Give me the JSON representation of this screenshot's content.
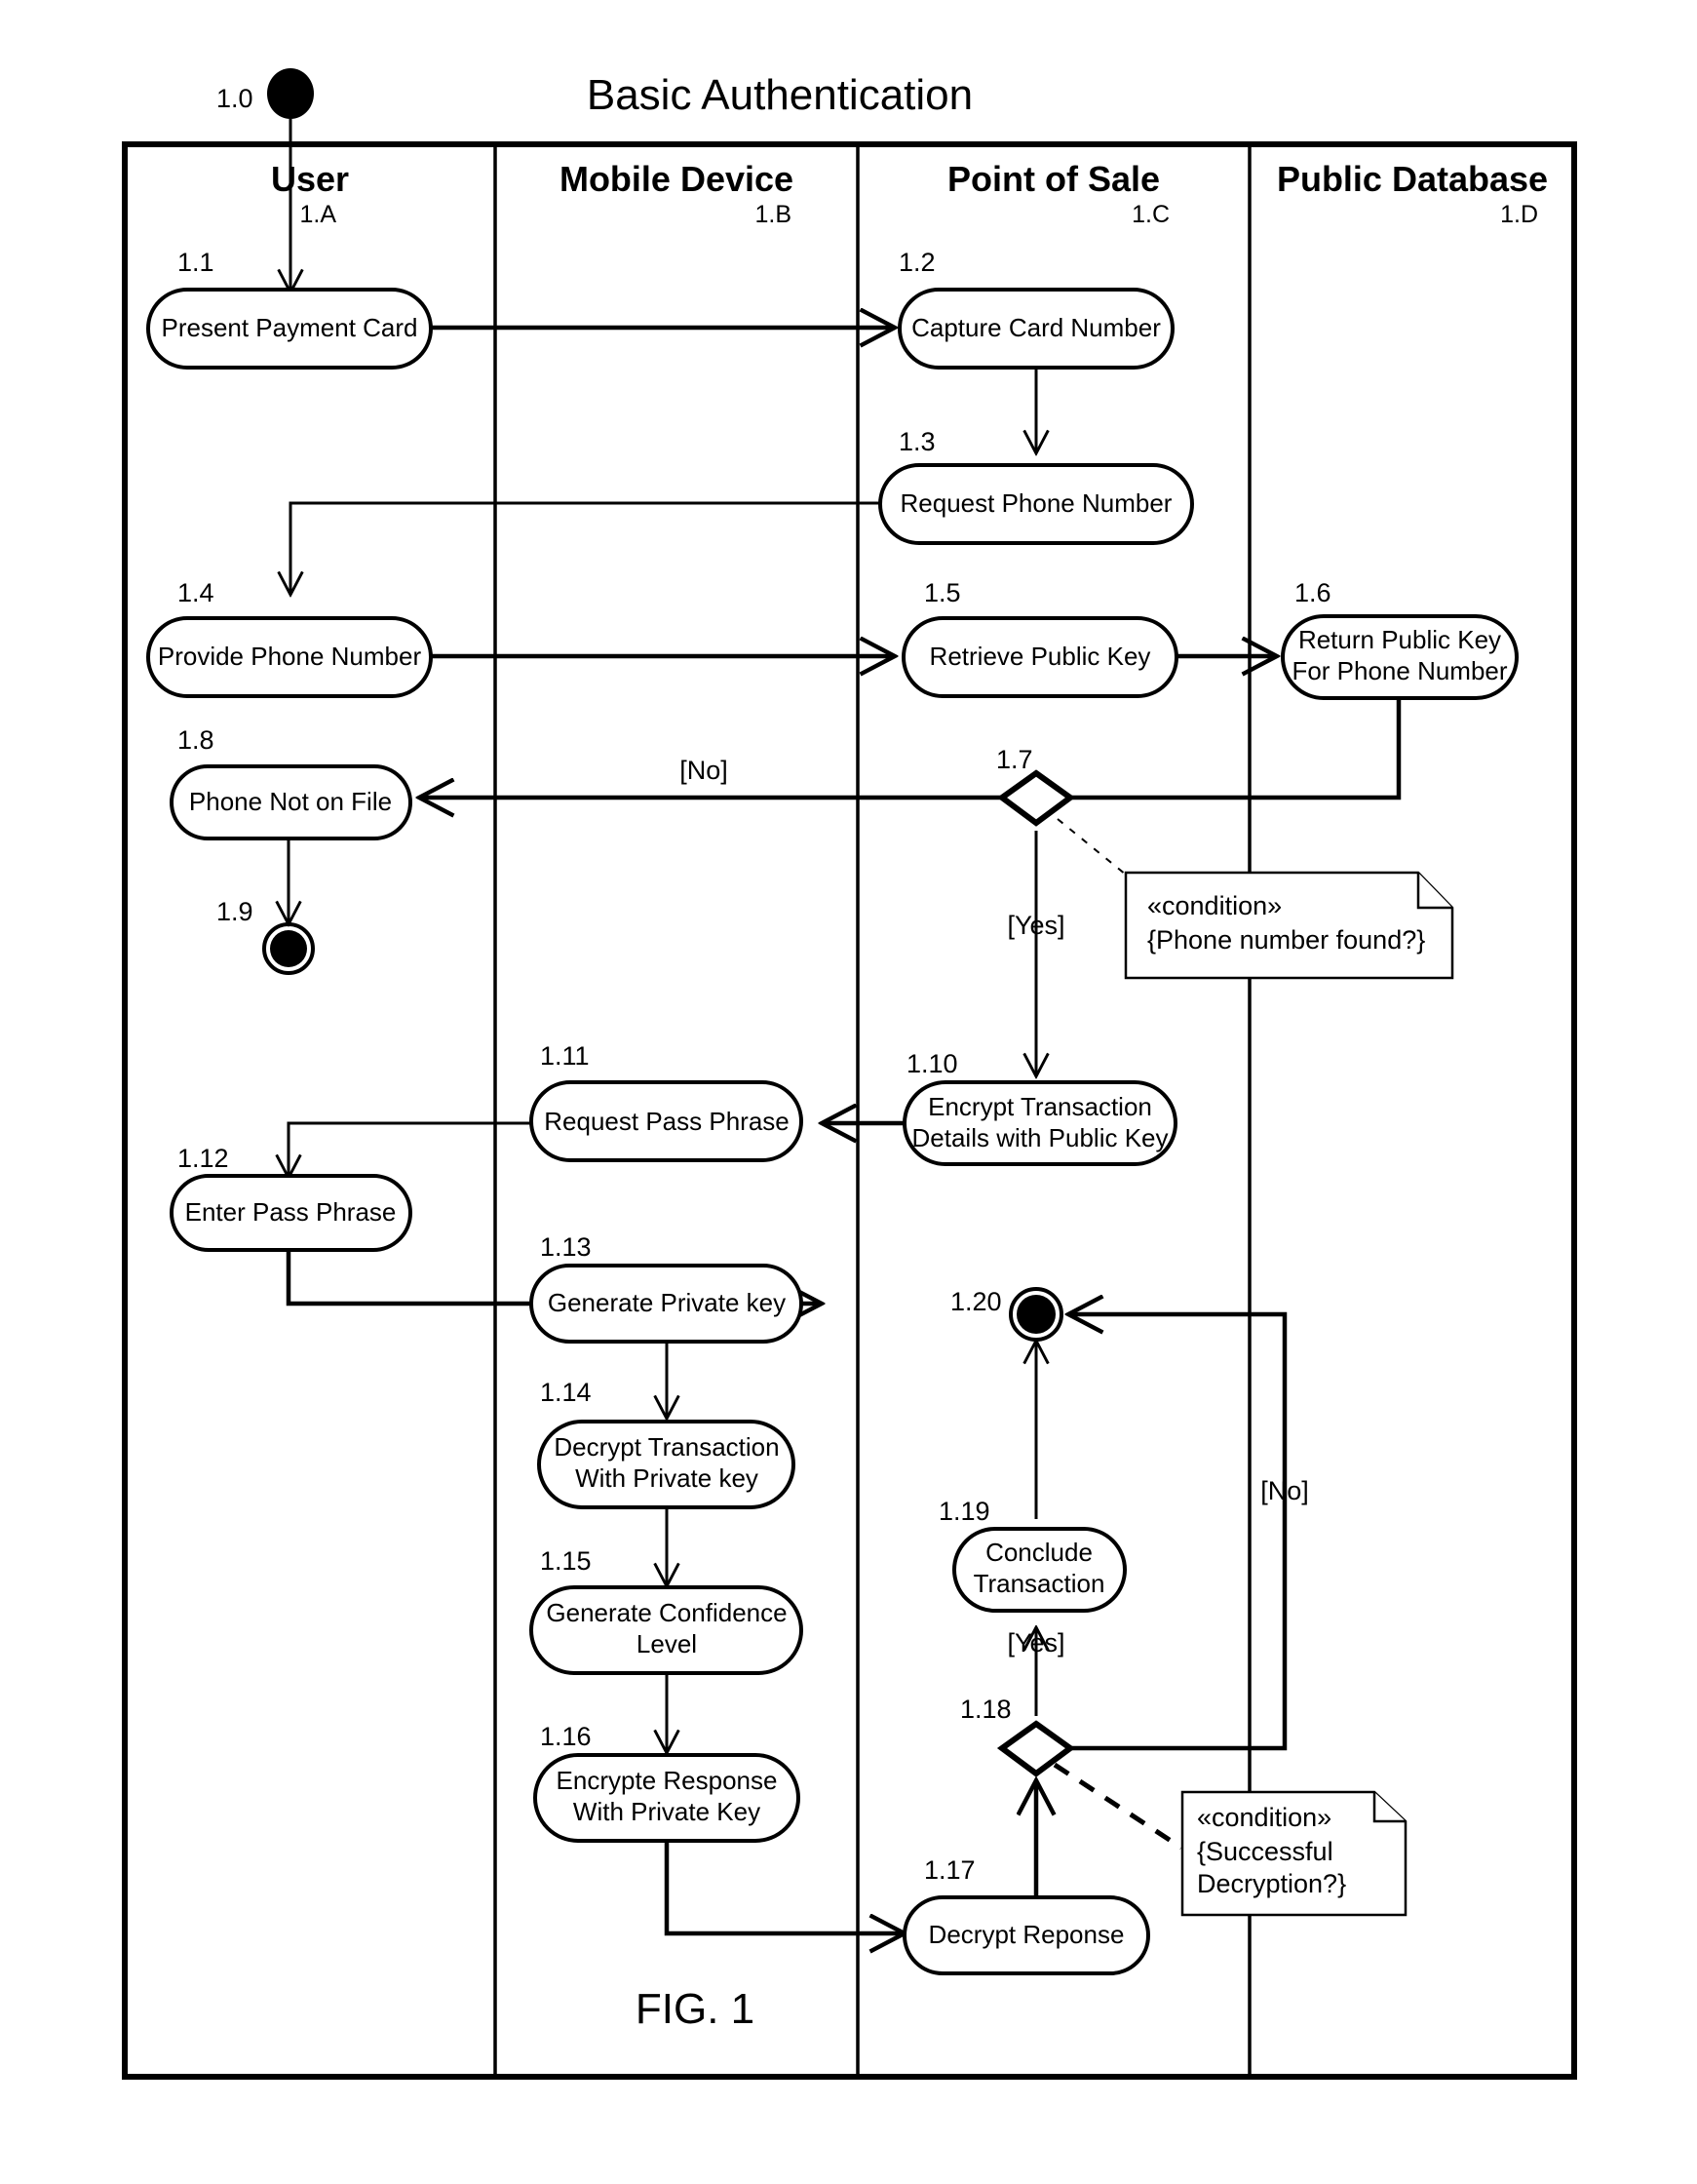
{
  "title": "Basic Authentication",
  "figure_label": "FIG. 1",
  "start_node": {
    "id": "1.0",
    "type": "initial-node"
  },
  "lanes": [
    {
      "name": "User",
      "num": "1.A"
    },
    {
      "name": "Mobile Device",
      "num": "1.B"
    },
    {
      "name": "Point of Sale",
      "num": "1.C"
    },
    {
      "name": "Public Database",
      "num": "1.D"
    }
  ],
  "nodes": [
    {
      "id": "1.1",
      "lane": "User",
      "type": "action",
      "label_line1": "Present Payment Card",
      "label_line2": ""
    },
    {
      "id": "1.2",
      "lane": "Point of Sale",
      "type": "action",
      "label_line1": "Capture Card Number",
      "label_line2": ""
    },
    {
      "id": "1.3",
      "lane": "Point of Sale",
      "type": "action",
      "label_line1": "Request Phone Number",
      "label_line2": ""
    },
    {
      "id": "1.4",
      "lane": "User",
      "type": "action",
      "label_line1": "Provide Phone Number",
      "label_line2": ""
    },
    {
      "id": "1.5",
      "lane": "Point of Sale",
      "type": "action",
      "label_line1": "Retrieve Public Key",
      "label_line2": ""
    },
    {
      "id": "1.6",
      "lane": "Public Database",
      "type": "action",
      "label_line1": "Return Public Key",
      "label_line2": "For Phone Number"
    },
    {
      "id": "1.7",
      "lane": "Point of Sale",
      "type": "decision",
      "label_line1": "",
      "label_line2": ""
    },
    {
      "id": "1.8",
      "lane": "User",
      "type": "action",
      "label_line1": "Phone Not on File",
      "label_line2": ""
    },
    {
      "id": "1.9",
      "lane": "User",
      "type": "final-node",
      "label_line1": "",
      "label_line2": ""
    },
    {
      "id": "1.10",
      "lane": "Point of Sale",
      "type": "action",
      "label_line1": "Encrypt Transaction",
      "label_line2": "Details with Public Key"
    },
    {
      "id": "1.11",
      "lane": "Mobile Device",
      "type": "action",
      "label_line1": "Request Pass Phrase",
      "label_line2": ""
    },
    {
      "id": "1.12",
      "lane": "User",
      "type": "action",
      "label_line1": "Enter Pass Phrase",
      "label_line2": ""
    },
    {
      "id": "1.13",
      "lane": "Mobile Device",
      "type": "action",
      "label_line1": "Generate Private key",
      "label_line2": ""
    },
    {
      "id": "1.14",
      "lane": "Mobile Device",
      "type": "action",
      "label_line1": "Decrypt Transaction",
      "label_line2": "With Private key"
    },
    {
      "id": "1.15",
      "lane": "Mobile Device",
      "type": "action",
      "label_line1": "Generate Confidence",
      "label_line2": "Level"
    },
    {
      "id": "1.16",
      "lane": "Mobile Device",
      "type": "action",
      "label_line1": "Encrypte Response",
      "label_line2": "With Private Key"
    },
    {
      "id": "1.17",
      "lane": "Point of Sale",
      "type": "action",
      "label_line1": "Decrypt Reponse",
      "label_line2": ""
    },
    {
      "id": "1.18",
      "lane": "Point of Sale",
      "type": "decision",
      "label_line1": "",
      "label_line2": ""
    },
    {
      "id": "1.19",
      "lane": "Point of Sale",
      "type": "action",
      "label_line1": "Conclude",
      "label_line2": "Transaction"
    },
    {
      "id": "1.20",
      "lane": "Point of Sale",
      "type": "final-node",
      "label_line1": "",
      "label_line2": ""
    }
  ],
  "guards": [
    {
      "id": "guard-1-7-no",
      "text": "[No]",
      "from": "1.7",
      "to": "1.8"
    },
    {
      "id": "guard-1-7-yes",
      "text": "[Yes]",
      "from": "1.7",
      "to": "1.10"
    },
    {
      "id": "guard-1-18-yes",
      "text": "[Yes]",
      "from": "1.18",
      "to": "1.19"
    },
    {
      "id": "guard-1-18-no",
      "text": "[No]",
      "from": "1.18",
      "to": "1.20"
    }
  ],
  "notes": [
    {
      "id": "note-1-7",
      "stereotype": "«condition»",
      "body": "{Phone number found?}",
      "body_line2": "",
      "attached_to": "1.7"
    },
    {
      "id": "note-1-18",
      "stereotype": "«condition»",
      "body": "{Successful",
      "body_line2": "Decryption?}",
      "attached_to": "1.18"
    }
  ],
  "colors": {
    "stroke": "#000000",
    "fill": "#ffffff",
    "background": "#ffffff"
  }
}
